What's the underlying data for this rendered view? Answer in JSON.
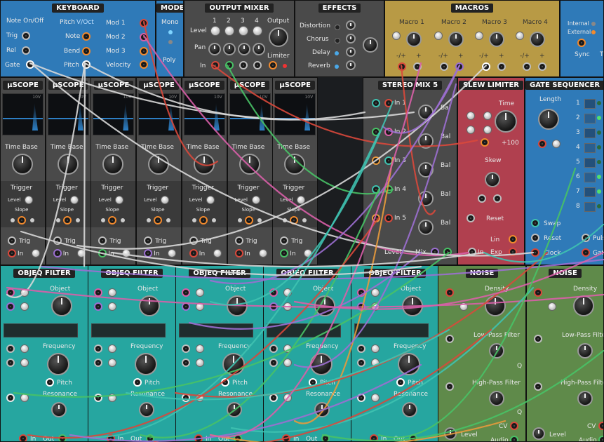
{
  "keyboard": {
    "title": "KEYBOARD",
    "labels": [
      "Note On/Off",
      "Trig",
      "Rel",
      "Gate",
      "Pitch",
      "V/Oct",
      "Note",
      "Bend",
      "Pitch",
      "Mod 1",
      "Mod 2",
      "Mod 3",
      "Velocity"
    ]
  },
  "mode": {
    "title": "MODE",
    "mono": "Mono",
    "poly": "Poly"
  },
  "output_mixer": {
    "title": "OUTPUT MIXER",
    "level": "Level",
    "pan": "Pan",
    "in": "In",
    "output": "Output",
    "limiter": "Limiter",
    "channels": [
      "1",
      "2",
      "3",
      "4"
    ]
  },
  "effects": {
    "title": "EFFECTS",
    "items": [
      "Distortion",
      "Chorus",
      "Delay",
      "Reverb"
    ]
  },
  "macros": {
    "title": "MACROS",
    "items": [
      "Macro 1",
      "Macro 2",
      "Macro 3",
      "Macro 4"
    ],
    "sign_labels": [
      "-/+",
      "+"
    ]
  },
  "clock": {
    "internal": "Internal",
    "external": "External",
    "sync": "Sync",
    "extra": "T"
  },
  "scope": {
    "title": "μSCOPE",
    "time_base": "Time Base",
    "trigger": "Trigger",
    "level": "Level",
    "slope": "Slope",
    "trig": "Trig",
    "in": "In",
    "range": "10V"
  },
  "stereo_mix": {
    "title": "STEREO MIX 5",
    "inputs": [
      "In 1",
      "In 2",
      "In 3",
      "In 4",
      "In 5"
    ],
    "bal": "Bal",
    "level": "Level",
    "mix": "Mix"
  },
  "slew": {
    "title": "SLEW LIMITER",
    "time": "Time",
    "plus100": "+100",
    "skew": "Skew",
    "reset": "Reset",
    "lin": "Lin",
    "in": "In",
    "exp": "Exp"
  },
  "gate_seq": {
    "title": "GATE SEQUENCER",
    "length": "Length",
    "steps": [
      "1",
      "2",
      "3",
      "4",
      "5",
      "6",
      "7",
      "8"
    ],
    "swap": "Swap",
    "reset": "Reset",
    "clock": "Clock",
    "pulse": "Pulse",
    "gate": "Gate"
  },
  "filter": {
    "title": "OBJEQ FILTER",
    "object": "Object",
    "frequency": "Frequency",
    "pitch": "Pitch",
    "resonance": "Resonance",
    "in": "In",
    "out": "Out"
  },
  "noise": {
    "title": "NOISE",
    "density": "Density",
    "lpf": "Low-Pass Filter",
    "hpf": "High-Pass Filter",
    "q": "Q",
    "cv": "CV",
    "audio": "Audio",
    "level": "Level"
  },
  "colors": {
    "accent": "#f28a2e",
    "cable_red": "#d9483b",
    "cable_purple": "#9c6fd1",
    "cable_green": "#48c266",
    "cable_white": "#d8d8d8",
    "cable_teal": "#3fc2b0",
    "cable_orange": "#e89a3c",
    "cable_pink": "#d95fa8"
  }
}
